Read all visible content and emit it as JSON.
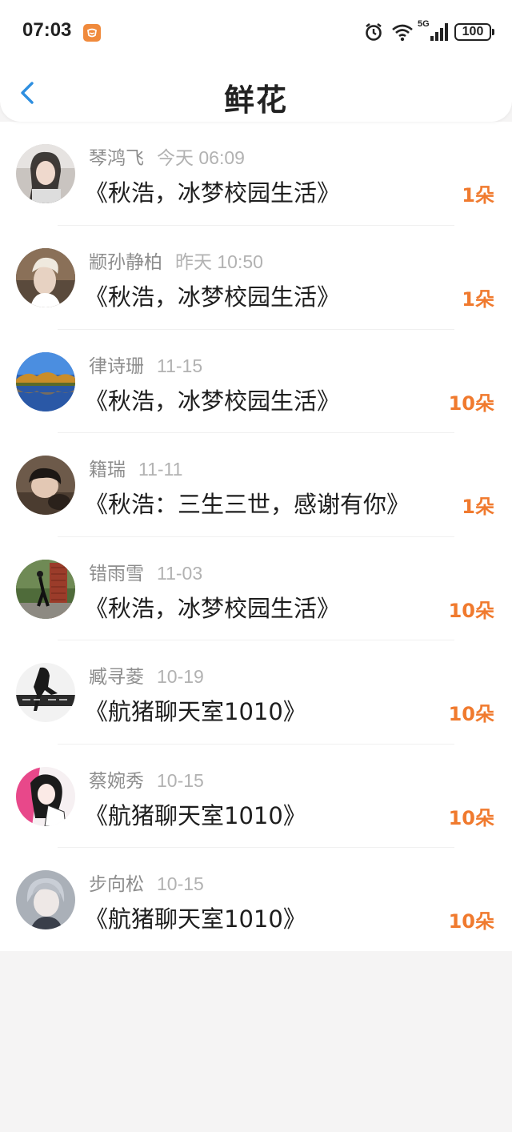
{
  "status_bar": {
    "time": "07:03",
    "battery": "100",
    "network": "5G"
  },
  "nav": {
    "title": "鲜花"
  },
  "colors": {
    "accent_orange": "#f07a2e",
    "back_blue": "#2e8fe0"
  },
  "items": [
    {
      "name": "琴鸿飞",
      "date": "今天 06:09",
      "room": "《秋浩，冰梦校园生活》",
      "count": "1朵"
    },
    {
      "name": "颛孙静柏",
      "date": "昨天 10:50",
      "room": "《秋浩，冰梦校园生活》",
      "count": "1朵"
    },
    {
      "name": "律诗珊",
      "date": "11-15",
      "room": "《秋浩，冰梦校园生活》",
      "count": "10朵"
    },
    {
      "name": "籍瑞",
      "date": "11-11",
      "room": "《秋浩：三生三世，感谢有你》",
      "count": "1朵"
    },
    {
      "name": "错雨雪",
      "date": "11-03",
      "room": "《秋浩，冰梦校园生活》",
      "count": "10朵"
    },
    {
      "name": "臧寻菱",
      "date": "10-19",
      "room": "《航猪聊天室1010》",
      "count": "10朵"
    },
    {
      "name": "蔡婉秀",
      "date": "10-15",
      "room": "《航猪聊天室1010》",
      "count": "10朵"
    },
    {
      "name": "步向松",
      "date": "10-15",
      "room": "《航猪聊天室1010》",
      "count": "10朵"
    }
  ]
}
